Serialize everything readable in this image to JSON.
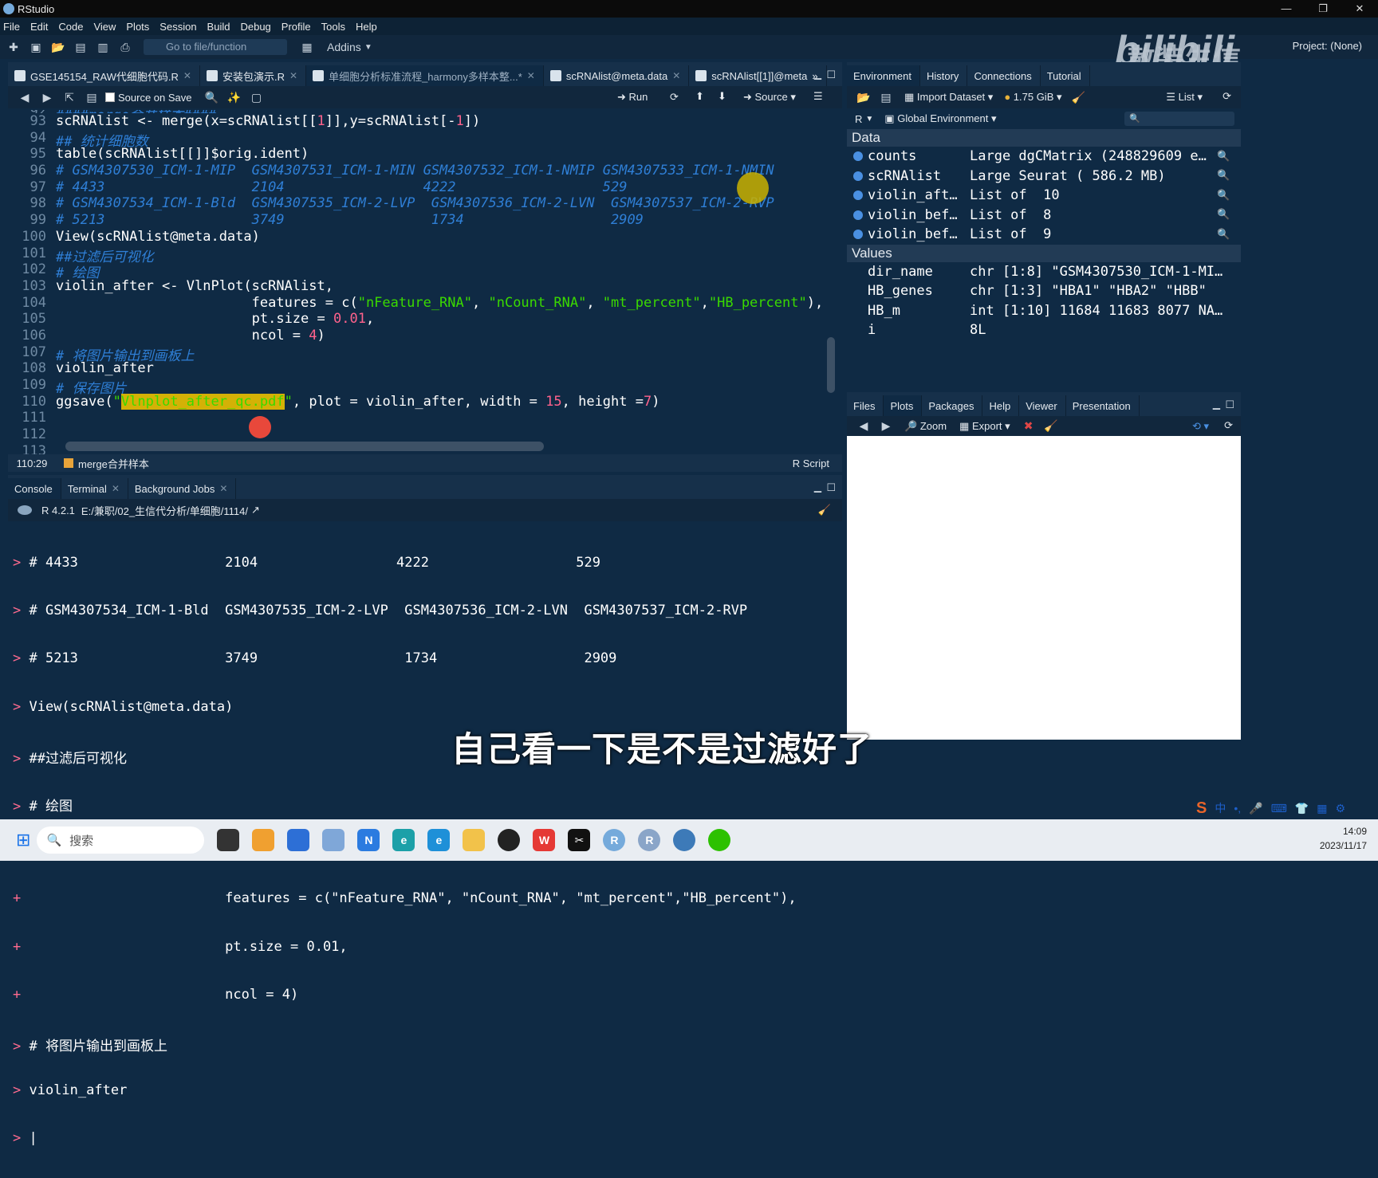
{
  "window": {
    "title": "RStudio"
  },
  "menu": [
    "File",
    "Edit",
    "Code",
    "View",
    "Plots",
    "Session",
    "Build",
    "Debug",
    "Profile",
    "Tools",
    "Help"
  ],
  "toolbar": {
    "goto_placeholder": "Go to file/function",
    "addins": "Addins",
    "project": "Project: (None)"
  },
  "watermark": {
    "text": "散装生信",
    "brand": "bilibili"
  },
  "editor": {
    "tabs": [
      {
        "label": "GSE145154_RAW代细胞代码.R",
        "active": false
      },
      {
        "label": "安装包演示.R",
        "active": false
      },
      {
        "label": "单细胞分析标准流程_harmony多样本整...*",
        "active": true
      },
      {
        "label": "scRNAlist@meta.data",
        "active": false
      },
      {
        "label": "scRNAlist[[1]]@meta",
        "active": false
      }
    ],
    "toolbar": {
      "source_on_save": "Source on Save",
      "run": "Run",
      "source": "Source"
    },
    "status": {
      "position": "110:29",
      "scope": "merge合并样本",
      "filetype": "R Script"
    }
  },
  "console": {
    "tabs": [
      "Console",
      "Terminal",
      "Background Jobs"
    ],
    "r_version": "R 4.2.1",
    "path": "E:/兼职/02_生信代分析/单细胞/1114/"
  },
  "environment": {
    "tabs": [
      "Environment",
      "History",
      "Connections",
      "Tutorial"
    ],
    "import_dataset": "Import Dataset",
    "memory": "1.75 GiB",
    "view_mode": "List",
    "r_label": "R",
    "scope": "Global Environment",
    "data_header": "Data",
    "values_header": "Values",
    "data": [
      {
        "name": "counts",
        "value": "Large dgCMatrix (248829609 e…"
      },
      {
        "name": "scRNAlist",
        "value": "Large Seurat ( 586.2 MB)"
      },
      {
        "name": "violin_aft…",
        "value": "List of  10"
      },
      {
        "name": "violin_bef…",
        "value": "List of  8"
      },
      {
        "name": "violin_bef…",
        "value": "List of  9"
      }
    ],
    "values": [
      {
        "name": "dir_name",
        "value": "chr [1:8] \"GSM4307530_ICM-1-MI…"
      },
      {
        "name": "HB_genes",
        "value": "chr [1:3] \"HBA1\" \"HBA2\" \"HBB\""
      },
      {
        "name": "HB_m",
        "value": "int [1:10] 11684 11683 8077 NA…"
      },
      {
        "name": "i",
        "value": "8L"
      }
    ]
  },
  "files": {
    "tabs": [
      "Files",
      "Plots",
      "Packages",
      "Help",
      "Viewer",
      "Presentation"
    ],
    "zoom": "Zoom",
    "export": "Export"
  },
  "subtitle": "自己看一下是不是过滤好了",
  "taskbar": {
    "search": "搜索",
    "time": "14:09",
    "date": "2023/11/17"
  }
}
